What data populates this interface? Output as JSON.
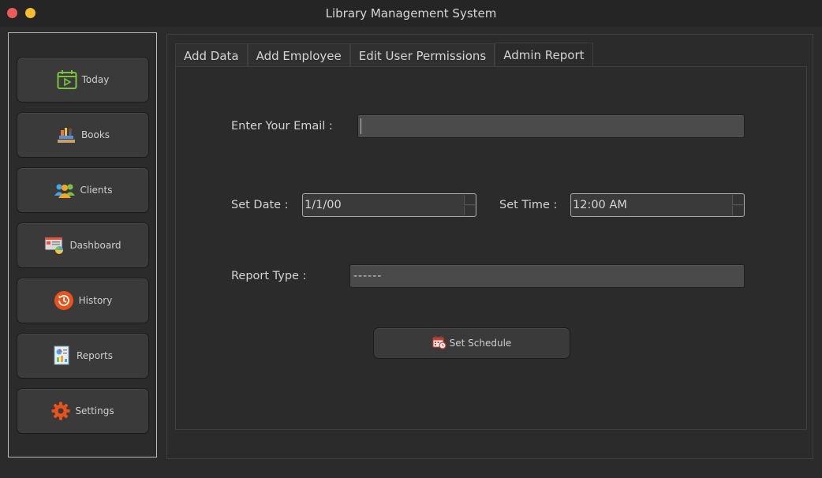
{
  "window": {
    "title": "Library Management System"
  },
  "sidebar": {
    "items": [
      {
        "label": "Today",
        "icon": "calendar-play-icon"
      },
      {
        "label": "Books",
        "icon": "books-icon"
      },
      {
        "label": "Clients",
        "icon": "clients-icon"
      },
      {
        "label": "Dashboard",
        "icon": "dashboard-icon"
      },
      {
        "label": "History",
        "icon": "history-icon"
      },
      {
        "label": "Reports",
        "icon": "reports-icon"
      },
      {
        "label": "Settings",
        "icon": "gear-icon"
      }
    ]
  },
  "tabs": [
    {
      "label": "Add Data",
      "active": false
    },
    {
      "label": "Add Employee",
      "active": false
    },
    {
      "label": "Edit User Permissions",
      "active": false
    },
    {
      "label": "Admin Report",
      "active": true
    }
  ],
  "form": {
    "email_label": "Enter Your Email :",
    "email_value": "",
    "date_label": "Set Date :",
    "date_value": "1/1/00",
    "time_label": "Set Time :",
    "time_value": "12:00 AM",
    "report_type_label": "Report Type :",
    "report_type_value": "------",
    "submit_label": "Set Schedule"
  },
  "colors": {
    "background": "#2b2b2b",
    "titlebar": "#252525",
    "close": "#ee5b58",
    "minimize": "#f4bd2f",
    "accent_orange": "#e8531c"
  }
}
